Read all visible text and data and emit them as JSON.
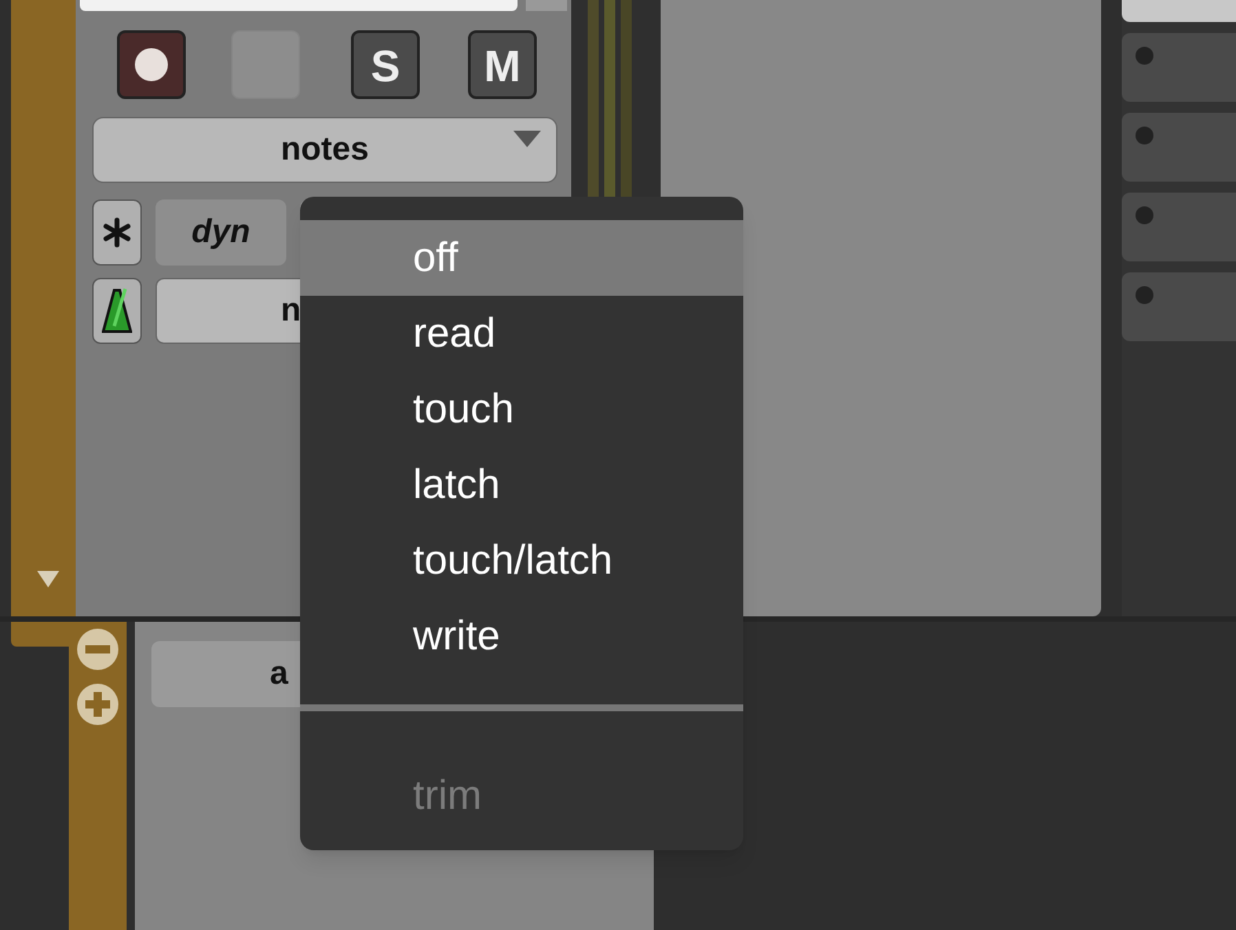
{
  "strip": {
    "solo_label": "S",
    "mute_label": "M",
    "notes_selector": "notes",
    "dyn_button": "dyn",
    "automation_button_partial": "n",
    "lower_button_partial": "a"
  },
  "automation_menu": {
    "items": [
      {
        "label": "off",
        "selected": true,
        "disabled": false
      },
      {
        "label": "read",
        "selected": false,
        "disabled": false
      },
      {
        "label": "touch",
        "selected": false,
        "disabled": false
      },
      {
        "label": "latch",
        "selected": false,
        "disabled": false
      },
      {
        "label": "touch/latch",
        "selected": false,
        "disabled": false
      },
      {
        "label": "write",
        "selected": false,
        "disabled": false
      },
      {
        "kind": "separator"
      },
      {
        "label": "trim",
        "selected": false,
        "disabled": true
      }
    ]
  },
  "side_rows": [
    {},
    {},
    {},
    {}
  ]
}
